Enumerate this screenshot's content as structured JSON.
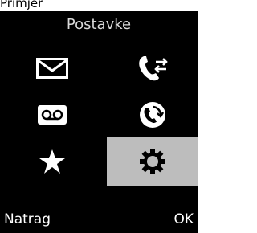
{
  "caption": "Primjer",
  "screen": {
    "title": "Postavke",
    "menu_items": [
      {
        "icon": "envelope-icon"
      },
      {
        "icon": "phone-transfer-icon"
      },
      {
        "icon": "voicemail-icon"
      },
      {
        "icon": "call-forward-icon"
      },
      {
        "icon": "star-icon"
      },
      {
        "icon": "gear-icon",
        "selected": true
      }
    ]
  },
  "softkeys": {
    "left_label": "Natrag",
    "right_label": "OK"
  },
  "colors": {
    "screen_bg": "#000000",
    "text": "#ffffff",
    "title_text": "#d9d9d9",
    "selection": "#bdbdbd"
  }
}
